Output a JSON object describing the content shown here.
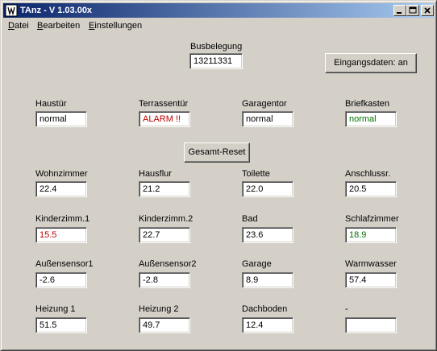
{
  "window": {
    "title": "TAnz - V 1.03.00x"
  },
  "menu": [
    {
      "label": "Datei",
      "accel": "D"
    },
    {
      "label": "Bearbeiten",
      "accel": "B"
    },
    {
      "label": "Einstellungen",
      "accel": "E"
    }
  ],
  "bus": {
    "label": "Busbelegung",
    "value": "13211331"
  },
  "buttons": {
    "eingangsdaten": "Eingangsdaten: an",
    "reset": "Gesamt-Reset"
  },
  "colors": {
    "alarm": "#c00000",
    "ok": "#007000",
    "normal": "#000000"
  },
  "doors": [
    {
      "label": "Haustür",
      "value": "normal",
      "status": "normal"
    },
    {
      "label": "Terrassentür",
      "value": "ALARM !!",
      "status": "alarm"
    },
    {
      "label": "Garagentor",
      "value": "normal",
      "status": "normal"
    },
    {
      "label": "Briefkasten",
      "value": "normal",
      "status": "ok"
    }
  ],
  "sensors": [
    [
      {
        "label": "Wohnzimmer",
        "value": "22.4",
        "status": "normal"
      },
      {
        "label": "Hausflur",
        "value": "21.2",
        "status": "normal"
      },
      {
        "label": "Toilette",
        "value": "22.0",
        "status": "normal"
      },
      {
        "label": "Anschlussr.",
        "value": "20.5",
        "status": "normal"
      }
    ],
    [
      {
        "label": "Kinderzimm.1",
        "value": "15.5",
        "status": "alarm"
      },
      {
        "label": "Kinderzimm.2",
        "value": "22.7",
        "status": "normal"
      },
      {
        "label": "Bad",
        "value": "23.6",
        "status": "normal"
      },
      {
        "label": "Schlafzimmer",
        "value": "18.9",
        "status": "ok"
      }
    ],
    [
      {
        "label": "Außensensor1",
        "value": "-2.6",
        "status": "normal"
      },
      {
        "label": "Außensensor2",
        "value": "-2.8",
        "status": "normal"
      },
      {
        "label": "Garage",
        "value": "8.9",
        "status": "normal"
      },
      {
        "label": "Warmwasser",
        "value": "57.4",
        "status": "normal"
      }
    ],
    [
      {
        "label": "Heizung 1",
        "value": "51.5",
        "status": "normal"
      },
      {
        "label": "Heizung 2",
        "value": "49.7",
        "status": "normal"
      },
      {
        "label": "Dachboden",
        "value": "12.4",
        "status": "normal"
      },
      {
        "label": "-",
        "value": "",
        "status": "normal"
      }
    ]
  ]
}
